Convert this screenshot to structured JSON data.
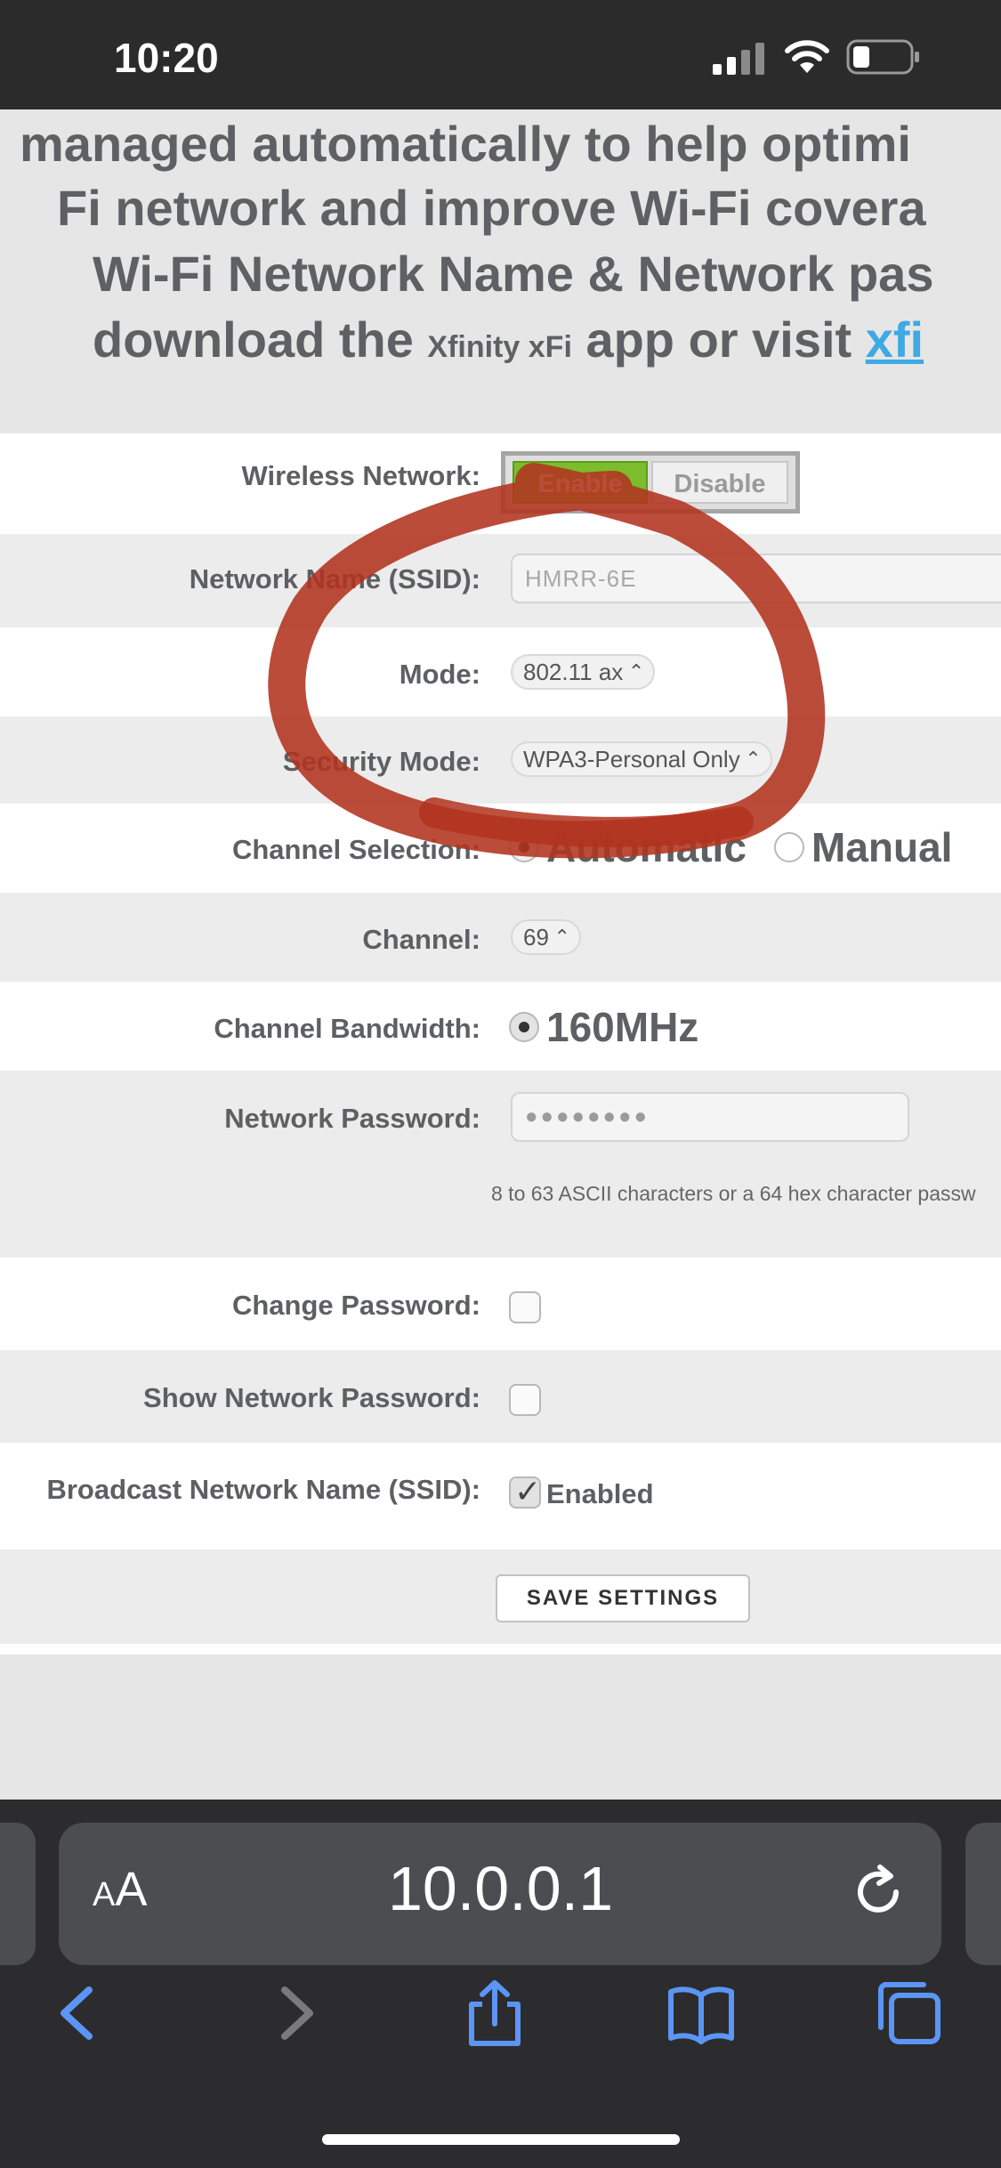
{
  "status_bar": {
    "time": "10:20"
  },
  "intro": {
    "line1": "managed automatically to help optimi",
    "line2": "Fi network and improve Wi-Fi covera",
    "line3": "Wi-Fi Network Name & Network pas",
    "line4_prefix": "download the ",
    "line4_brand": "Xfinity xFi",
    "line4_mid": " app or visit ",
    "line4_link": "xfi"
  },
  "form": {
    "wireless_network": {
      "label": "Wireless Network:",
      "enable": "Enable",
      "disable": "Disable"
    },
    "ssid": {
      "label": "Network Name (SSID):",
      "value": "HMRR-6E"
    },
    "mode": {
      "label": "Mode:",
      "value": "802.11 ax"
    },
    "security_mode": {
      "label": "Security Mode:",
      "value": "WPA3-Personal Only"
    },
    "channel_selection": {
      "label": "Channel Selection:",
      "automatic": "Automatic",
      "manual": "Manual"
    },
    "channel": {
      "label": "Channel:",
      "value": "69"
    },
    "channel_bandwidth": {
      "label": "Channel Bandwidth:",
      "value": "160MHz"
    },
    "network_password": {
      "label": "Network Password:",
      "value": "●●●●●●●●",
      "hint": "8 to 63 ASCII characters or a 64 hex character passw"
    },
    "change_password": {
      "label": "Change Password:"
    },
    "show_password": {
      "label": "Show Network Password:"
    },
    "broadcast_ssid": {
      "label": "Broadcast Network Name (SSID):",
      "value": "Enabled"
    },
    "save_button": "SAVE SETTINGS"
  },
  "browser": {
    "aa_label_big": "A",
    "aa_label_small": "A",
    "url": "10.0.0.1"
  },
  "colors": {
    "enable_green": "#7bbd2c",
    "annotation_red": "#b2331f",
    "link_blue": "#3fa9e3"
  },
  "icons": [
    "signal-icon",
    "wifi-icon",
    "battery-icon",
    "reload-icon",
    "back-icon",
    "forward-icon",
    "share-icon",
    "bookmarks-icon",
    "tabs-icon"
  ]
}
